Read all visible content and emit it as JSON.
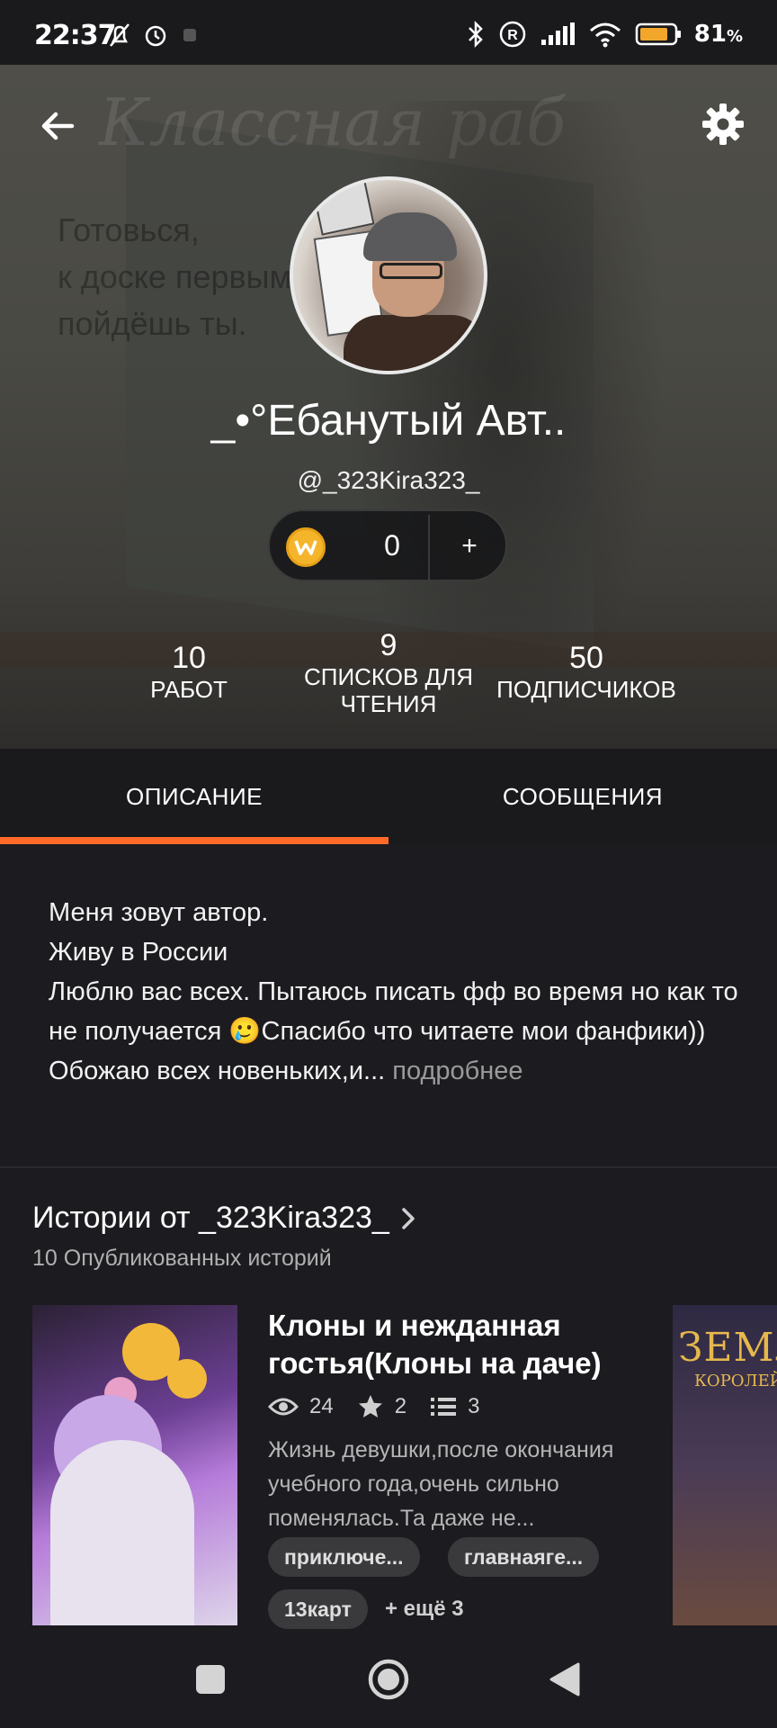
{
  "status_bar": {
    "time": "22:37",
    "battery_percent": "81",
    "icons": [
      "bell-off-icon",
      "alarm-icon",
      "bluetooth-icon",
      "roaming-icon",
      "signal-icon",
      "wifi-icon",
      "battery-icon"
    ]
  },
  "header": {
    "back_icon": "back-arrow-icon",
    "settings_icon": "gear-icon",
    "banner_script": "Классная раб",
    "banner_note_line1": "Готовься,",
    "banner_note_line2": "к доске первым",
    "banner_note_line3": "пойдёшь ты."
  },
  "profile": {
    "display_name": "_•°Ебанутый Авт..",
    "username": "@_323Kira323_",
    "coins": {
      "count": "0",
      "plus": "+"
    },
    "stats": [
      {
        "num": "10",
        "label": "Работ"
      },
      {
        "num": "9",
        "label": "Списков для чтения"
      },
      {
        "num": "50",
        "label": "Подписчиков"
      }
    ]
  },
  "tabs": [
    {
      "label": "ОПИСАНИЕ",
      "active": true
    },
    {
      "label": "СООБЩЕНИЯ",
      "active": false
    }
  ],
  "description": {
    "line1": "Меня зовут автор.",
    "line2": "Живу в России",
    "line3": "Люблю вас всех. Пытаюсь писать фф во время но как то не получается 🥲Спасибо что читаете мои фанфики)) Обожаю всех новеньких,и...",
    "more": " подробнее"
  },
  "stories": {
    "title": "Истории от _323Kira323_",
    "subtitle": "10 Опубликованных историй",
    "book": {
      "title": "Клоны и нежданная гостья(Клоны на даче)",
      "views": "24",
      "stars": "2",
      "parts": "3",
      "description": "Жизнь девушки,после окончания учебного года,очень сильно поменялась.Та даже не...",
      "tags": [
        "приключе...",
        "главнаяге...",
        "13карт"
      ],
      "more_tags": "+ ещё 3"
    },
    "next_cover_title": "ЗЕМЛЯ",
    "next_cover_sub": "КОРОЛЕЙ"
  },
  "navbar": {
    "recents_icon": "square-icon",
    "home_icon": "circle-icon",
    "back_icon": "triangle-back-icon"
  },
  "colors": {
    "accent": "#ff6a2b",
    "background": "#1c1b1f",
    "coin": "#f5b52a"
  }
}
